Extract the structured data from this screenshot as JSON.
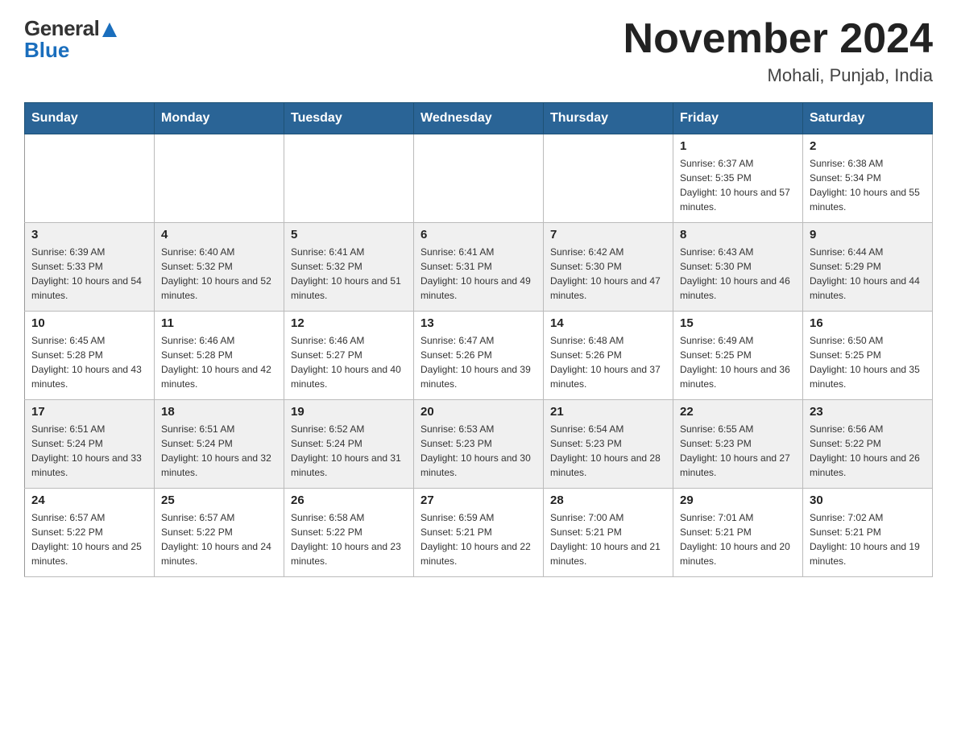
{
  "header": {
    "logo_general": "General",
    "logo_blue": "Blue",
    "month_title": "November 2024",
    "location": "Mohali, Punjab, India"
  },
  "days_of_week": [
    "Sunday",
    "Monday",
    "Tuesday",
    "Wednesday",
    "Thursday",
    "Friday",
    "Saturday"
  ],
  "weeks": [
    {
      "row_class": "row-odd",
      "days": [
        {
          "number": "",
          "info": ""
        },
        {
          "number": "",
          "info": ""
        },
        {
          "number": "",
          "info": ""
        },
        {
          "number": "",
          "info": ""
        },
        {
          "number": "",
          "info": ""
        },
        {
          "number": "1",
          "info": "Sunrise: 6:37 AM\nSunset: 5:35 PM\nDaylight: 10 hours and 57 minutes."
        },
        {
          "number": "2",
          "info": "Sunrise: 6:38 AM\nSunset: 5:34 PM\nDaylight: 10 hours and 55 minutes."
        }
      ]
    },
    {
      "row_class": "row-even",
      "days": [
        {
          "number": "3",
          "info": "Sunrise: 6:39 AM\nSunset: 5:33 PM\nDaylight: 10 hours and 54 minutes."
        },
        {
          "number": "4",
          "info": "Sunrise: 6:40 AM\nSunset: 5:32 PM\nDaylight: 10 hours and 52 minutes."
        },
        {
          "number": "5",
          "info": "Sunrise: 6:41 AM\nSunset: 5:32 PM\nDaylight: 10 hours and 51 minutes."
        },
        {
          "number": "6",
          "info": "Sunrise: 6:41 AM\nSunset: 5:31 PM\nDaylight: 10 hours and 49 minutes."
        },
        {
          "number": "7",
          "info": "Sunrise: 6:42 AM\nSunset: 5:30 PM\nDaylight: 10 hours and 47 minutes."
        },
        {
          "number": "8",
          "info": "Sunrise: 6:43 AM\nSunset: 5:30 PM\nDaylight: 10 hours and 46 minutes."
        },
        {
          "number": "9",
          "info": "Sunrise: 6:44 AM\nSunset: 5:29 PM\nDaylight: 10 hours and 44 minutes."
        }
      ]
    },
    {
      "row_class": "row-odd",
      "days": [
        {
          "number": "10",
          "info": "Sunrise: 6:45 AM\nSunset: 5:28 PM\nDaylight: 10 hours and 43 minutes."
        },
        {
          "number": "11",
          "info": "Sunrise: 6:46 AM\nSunset: 5:28 PM\nDaylight: 10 hours and 42 minutes."
        },
        {
          "number": "12",
          "info": "Sunrise: 6:46 AM\nSunset: 5:27 PM\nDaylight: 10 hours and 40 minutes."
        },
        {
          "number": "13",
          "info": "Sunrise: 6:47 AM\nSunset: 5:26 PM\nDaylight: 10 hours and 39 minutes."
        },
        {
          "number": "14",
          "info": "Sunrise: 6:48 AM\nSunset: 5:26 PM\nDaylight: 10 hours and 37 minutes."
        },
        {
          "number": "15",
          "info": "Sunrise: 6:49 AM\nSunset: 5:25 PM\nDaylight: 10 hours and 36 minutes."
        },
        {
          "number": "16",
          "info": "Sunrise: 6:50 AM\nSunset: 5:25 PM\nDaylight: 10 hours and 35 minutes."
        }
      ]
    },
    {
      "row_class": "row-even",
      "days": [
        {
          "number": "17",
          "info": "Sunrise: 6:51 AM\nSunset: 5:24 PM\nDaylight: 10 hours and 33 minutes."
        },
        {
          "number": "18",
          "info": "Sunrise: 6:51 AM\nSunset: 5:24 PM\nDaylight: 10 hours and 32 minutes."
        },
        {
          "number": "19",
          "info": "Sunrise: 6:52 AM\nSunset: 5:24 PM\nDaylight: 10 hours and 31 minutes."
        },
        {
          "number": "20",
          "info": "Sunrise: 6:53 AM\nSunset: 5:23 PM\nDaylight: 10 hours and 30 minutes."
        },
        {
          "number": "21",
          "info": "Sunrise: 6:54 AM\nSunset: 5:23 PM\nDaylight: 10 hours and 28 minutes."
        },
        {
          "number": "22",
          "info": "Sunrise: 6:55 AM\nSunset: 5:23 PM\nDaylight: 10 hours and 27 minutes."
        },
        {
          "number": "23",
          "info": "Sunrise: 6:56 AM\nSunset: 5:22 PM\nDaylight: 10 hours and 26 minutes."
        }
      ]
    },
    {
      "row_class": "row-odd",
      "days": [
        {
          "number": "24",
          "info": "Sunrise: 6:57 AM\nSunset: 5:22 PM\nDaylight: 10 hours and 25 minutes."
        },
        {
          "number": "25",
          "info": "Sunrise: 6:57 AM\nSunset: 5:22 PM\nDaylight: 10 hours and 24 minutes."
        },
        {
          "number": "26",
          "info": "Sunrise: 6:58 AM\nSunset: 5:22 PM\nDaylight: 10 hours and 23 minutes."
        },
        {
          "number": "27",
          "info": "Sunrise: 6:59 AM\nSunset: 5:21 PM\nDaylight: 10 hours and 22 minutes."
        },
        {
          "number": "28",
          "info": "Sunrise: 7:00 AM\nSunset: 5:21 PM\nDaylight: 10 hours and 21 minutes."
        },
        {
          "number": "29",
          "info": "Sunrise: 7:01 AM\nSunset: 5:21 PM\nDaylight: 10 hours and 20 minutes."
        },
        {
          "number": "30",
          "info": "Sunrise: 7:02 AM\nSunset: 5:21 PM\nDaylight: 10 hours and 19 minutes."
        }
      ]
    }
  ]
}
